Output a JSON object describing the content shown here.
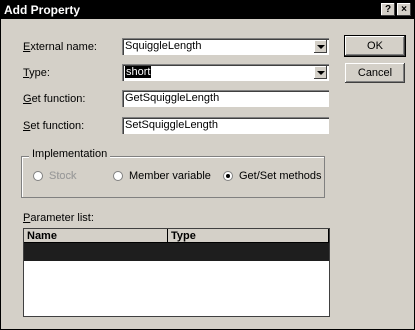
{
  "window": {
    "title": "Add Property",
    "help_btn": "?",
    "close_btn": "×"
  },
  "fields": {
    "external_name": {
      "label_u": "E",
      "label_rest": "xternal name:",
      "value": "SquiggleLength"
    },
    "type": {
      "label_u": "T",
      "label_rest": "ype:",
      "value": "short"
    },
    "get_function": {
      "label_u": "G",
      "label_rest": "et function:",
      "value": "GetSquiggleLength"
    },
    "set_function": {
      "label_u": "S",
      "label_rest": "et function:",
      "value": "SetSquiggleLength"
    }
  },
  "buttons": {
    "ok": "OK",
    "cancel": "Cancel"
  },
  "implementation": {
    "title": "Implementation",
    "options": [
      {
        "label": "Stock",
        "selected": false,
        "disabled": true
      },
      {
        "label": "Member variable",
        "selected": false,
        "disabled": false
      },
      {
        "label": "Get/Set methods",
        "selected": true,
        "disabled": false
      }
    ]
  },
  "parameters": {
    "label_u": "P",
    "label_rest": "arameter list:",
    "columns": [
      "Name",
      "Type"
    ]
  }
}
